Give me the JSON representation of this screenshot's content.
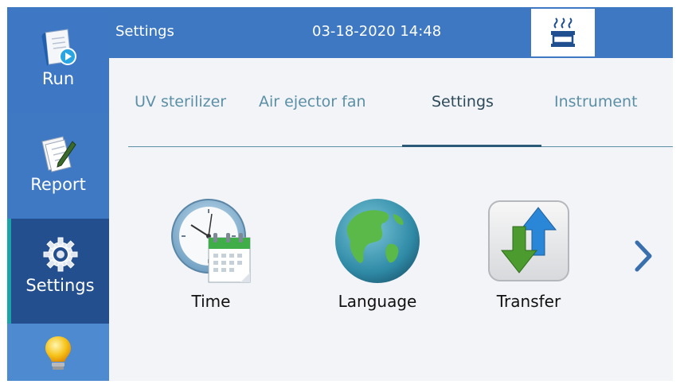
{
  "sidebar": {
    "items": [
      {
        "label": "Run",
        "icon": "run-document-icon"
      },
      {
        "label": "Report",
        "icon": "report-pencil-icon"
      },
      {
        "label": "Settings",
        "icon": "gear-icon"
      },
      {
        "label": "",
        "icon": "lightbulb-icon"
      }
    ],
    "active": "Settings"
  },
  "header": {
    "title": "Settings",
    "datetime": "03-18-2020 14:48",
    "heater_icon": "heater-icon"
  },
  "tabs": [
    {
      "label": "UV sterilizer"
    },
    {
      "label": "Air ejector fan"
    },
    {
      "label": "Settings"
    },
    {
      "label": "Instrument"
    }
  ],
  "active_tab": "Settings",
  "tiles": [
    {
      "label": "Time",
      "icon": "clock-calendar-icon"
    },
    {
      "label": "Language",
      "icon": "globe-icon"
    },
    {
      "label": "Transfer",
      "icon": "transfer-arrows-icon"
    }
  ],
  "colors": {
    "header_blue": "#3f78c2",
    "sidebar_active": "#244f8e",
    "tab_text": "#5b8fa6",
    "tab_active_underline": "#2b5a78"
  }
}
